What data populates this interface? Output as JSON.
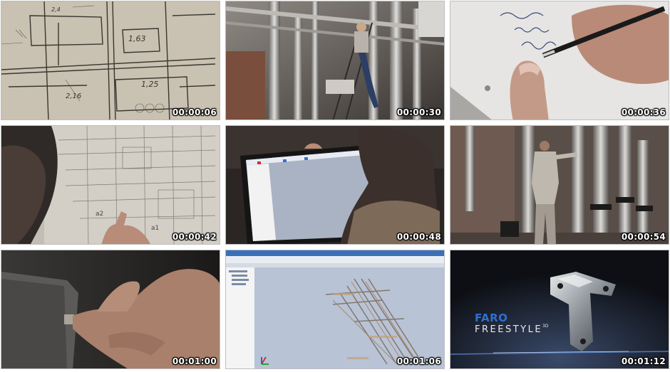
{
  "thumbnails": [
    {
      "timestamp": "00:00:06",
      "scene": "blueprint-closeup"
    },
    {
      "timestamp": "00:00:30",
      "scene": "worker-on-ladder-pipes"
    },
    {
      "timestamp": "00:00:36",
      "scene": "hand-writing-notes"
    },
    {
      "timestamp": "00:00:42",
      "scene": "man-reading-blueprint"
    },
    {
      "timestamp": "00:00:48",
      "scene": "tablet-software"
    },
    {
      "timestamp": "00:00:54",
      "scene": "worker-scanning-pipes"
    },
    {
      "timestamp": "00:01:00",
      "scene": "hand-on-scanner"
    },
    {
      "timestamp": "00:01:06",
      "scene": "point-cloud-software"
    },
    {
      "timestamp": "00:01:12",
      "scene": "faro-freestyle-product"
    }
  ],
  "branding": {
    "logo": "FARO",
    "product": "FREESTYLE",
    "product_suffix": "3D"
  },
  "colors": {
    "logo_blue": "#2f6fd0",
    "timestamp_text": "#ffffff"
  }
}
